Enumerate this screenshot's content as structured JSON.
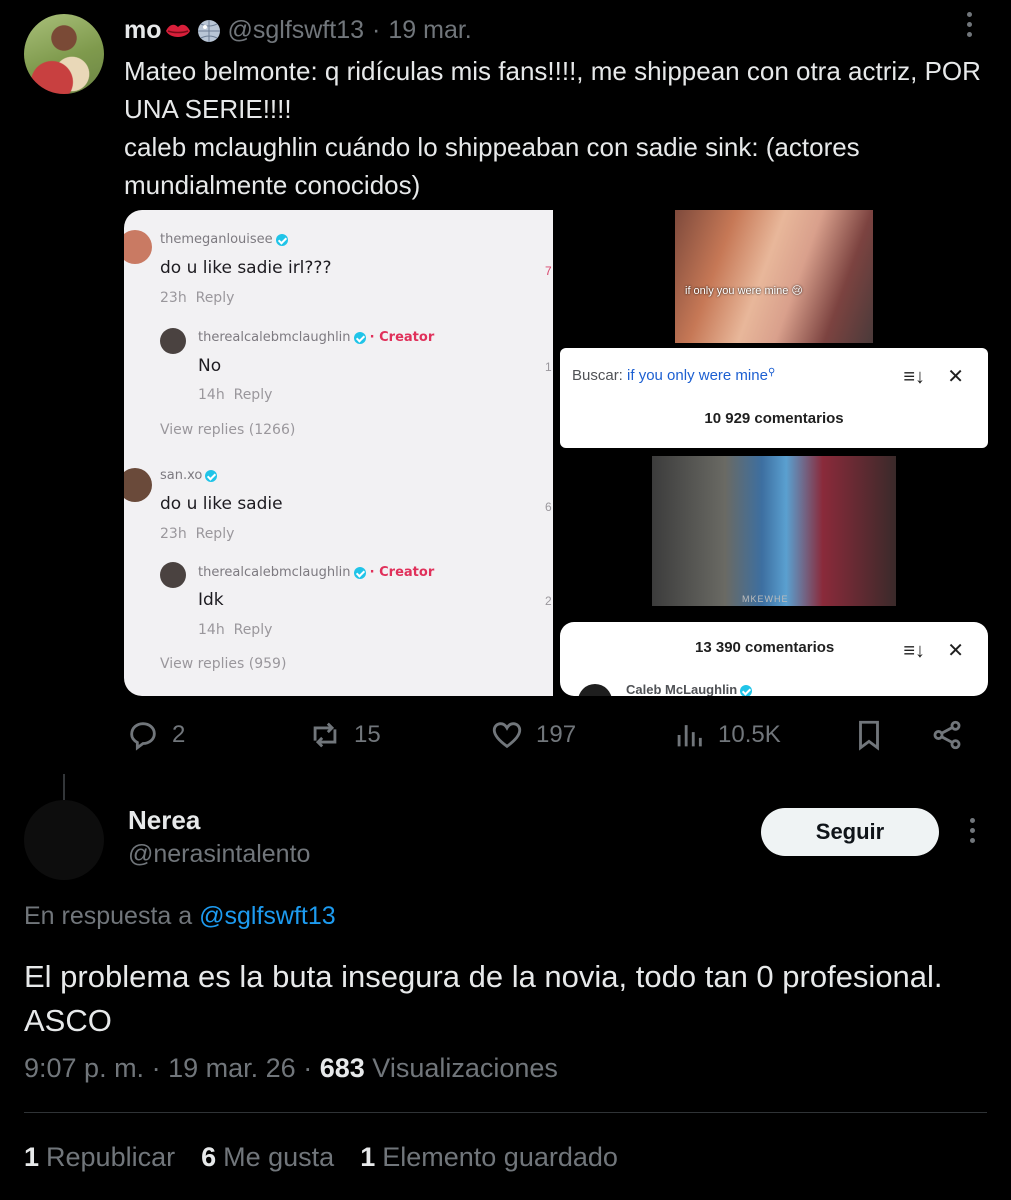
{
  "parent_tweet": {
    "name": "mo",
    "handle": "@sglfswft13",
    "separator": "·",
    "date": "19 mar.",
    "text_lines": [
      "Mateo belmonte: q ridículas mis fans!!!!, me shippean con otra actriz, POR UNA SERIE!!!!",
      "caleb mclaughlin cuándo lo shippeaban con sadie sink: (actores mundialmente conocidos)"
    ],
    "media": {
      "comments_screenshot": {
        "c1_user": "themeganlouisee",
        "c1_text": "do u like sadie irl???",
        "c1_time": "23h",
        "c1_reply": "Reply",
        "c1_edge": "7",
        "c2_user": "therealcalebmclaughlin",
        "c2_badge": "· Creator",
        "c2_text": "No",
        "c2_time": "14h",
        "c2_reply": "Reply",
        "c2_edge": "1",
        "view1": "View replies (1266)",
        "c3_user": "san.xo",
        "c3_text": "do u like sadie",
        "c3_time": "23h",
        "c3_reply": "Reply",
        "c3_edge": "6",
        "c4_user": "therealcalebmclaughlin",
        "c4_badge": "· Creator",
        "c4_text": "Idk",
        "c4_time": "14h",
        "c4_reply": "Reply",
        "c4_edge": "2",
        "view2": "View replies (959)"
      },
      "photo_caption": "if only you were mine 😢",
      "search_card": {
        "label": "Buscar:",
        "query": "if you only were mine",
        "count": "10 929 comentarios"
      },
      "photo2_watermark": "MKEWHE",
      "count_card": {
        "count": "13 390 comentarios",
        "user": "Caleb McLaughlin"
      }
    },
    "actions": {
      "replies": "2",
      "reposts": "15",
      "likes": "197",
      "views": "10.5K"
    }
  },
  "reply_tweet": {
    "name": "Nerea",
    "handle": "@nerasintalento",
    "follow_label": "Seguir",
    "reply_prefix": "En respuesta a",
    "reply_to_handle": "@sglfswft13",
    "text": "El problema es la buta insegura de la novia, todo tan 0 profesional. ASCO",
    "time": "9:07 p. m.",
    "sep": "·",
    "date": "19 mar. 26",
    "views_count": "683",
    "views_label": "Visualizaciones",
    "stats": [
      {
        "count": "1",
        "label": "Republicar"
      },
      {
        "count": "6",
        "label": "Me gusta"
      },
      {
        "count": "1",
        "label": "Elemento guardado"
      }
    ]
  },
  "colors": {
    "background": "#000000",
    "text_primary": "#e7e9ea",
    "text_secondary": "#71767b",
    "link": "#1d9bf0",
    "creator_badge": "#e0305a"
  }
}
